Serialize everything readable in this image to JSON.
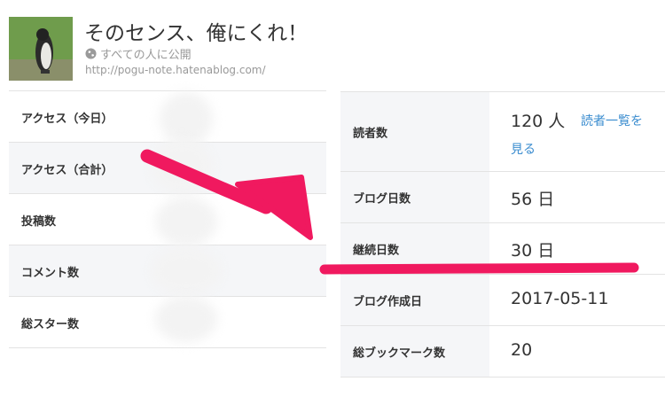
{
  "blog": {
    "title": "そのセンス、俺にくれ！",
    "visibility": "すべての人に公開",
    "url": "http://pogu-note.hatenablog.com/"
  },
  "left_stats": [
    {
      "label": "アクセス（今日）"
    },
    {
      "label": "アクセス（合計）"
    },
    {
      "label": "投稿数"
    },
    {
      "label": "コメント数"
    },
    {
      "label": "総スター数"
    }
  ],
  "right_stats": {
    "readers": {
      "label": "読者数",
      "value": "120",
      "unit": "人",
      "link_line1": "読者一覧を",
      "link_line2": "見る"
    },
    "blog_days": {
      "label": "ブログ日数",
      "value": "56",
      "unit": "日"
    },
    "streak_days": {
      "label": "継続日数",
      "value": "30",
      "unit": "日"
    },
    "created": {
      "label": "ブログ作成日",
      "value": "2017-05-11"
    },
    "bookmarks": {
      "label": "総ブックマーク数",
      "value": "20"
    }
  },
  "colors": {
    "annotation": "#f0195f",
    "link": "#3a8ccf",
    "row_shade": "#f5f6f8"
  },
  "icons": {
    "globe": "globe-icon",
    "blog_thumbnail": "penguin-photo"
  }
}
